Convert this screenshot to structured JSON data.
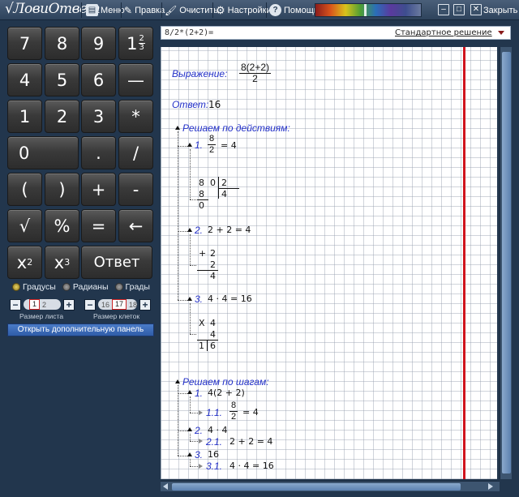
{
  "titlebar": {
    "app_title": "ЛовиОтвет",
    "menu_label": "Меню",
    "edit_label": "Правка",
    "clear_label": "Очистить",
    "settings_label": "Настройки",
    "help_label": "Помощь",
    "help_icon": "?",
    "close_label": "Закрыть"
  },
  "keypad": {
    "keys": [
      {
        "id": "key-7",
        "label": "7"
      },
      {
        "id": "key-8",
        "label": "8"
      },
      {
        "id": "key-9",
        "label": "9"
      },
      {
        "id": "key-4",
        "label": "4"
      },
      {
        "id": "key-5",
        "label": "5"
      },
      {
        "id": "key-6",
        "label": "6"
      },
      {
        "id": "key-fraction-bar",
        "label": "—"
      },
      {
        "id": "key-1",
        "label": "1"
      },
      {
        "id": "key-2",
        "label": "2"
      },
      {
        "id": "key-3",
        "label": "3"
      },
      {
        "id": "key-multiply",
        "label": "*"
      },
      {
        "id": "key-0",
        "label": "0"
      },
      {
        "id": "key-dot",
        "label": "."
      },
      {
        "id": "key-divide",
        "label": "/"
      },
      {
        "id": "key-open-paren",
        "label": "("
      },
      {
        "id": "key-close-paren",
        "label": ")"
      },
      {
        "id": "key-plus",
        "label": "+"
      },
      {
        "id": "key-minus",
        "label": "-"
      },
      {
        "id": "key-sqrt",
        "label": "√"
      },
      {
        "id": "key-percent",
        "label": "%"
      },
      {
        "id": "key-equals",
        "label": "="
      },
      {
        "id": "key-backspace",
        "label": "←"
      }
    ],
    "mixed_whole": "1",
    "mixed_num": "2",
    "mixed_den": "3",
    "x": "x",
    "sq_exp": "2",
    "cube_exp": "3",
    "answer_label": "Ответ",
    "angle_modes": [
      "Градусы",
      "Радианы",
      "Грады"
    ],
    "sheet_size": {
      "prev": "",
      "current": "1",
      "next": "2",
      "label": "Размер листа"
    },
    "cell_size": {
      "prev": "16",
      "current": "17",
      "next": "18",
      "label": "Размер клеток"
    },
    "extra_panel_label": "Открыть дополнительную панель"
  },
  "expression_bar": {
    "expression": "8/2*(2+2)=",
    "mode": "Стандартное решение"
  },
  "solution": {
    "expr_label": "Выражение:",
    "expr_num": "8(2+2)",
    "expr_den": "2",
    "answer_label": "Ответ:",
    "answer_value": "16",
    "by_actions_label": "Решаем по действиям:",
    "a1": {
      "num_label": "1.",
      "num": "8",
      "den": "2",
      "eq": "= 4",
      "div_dividend": "8",
      "div_zero": "0",
      "div_divisor": "2",
      "div_quot": "4",
      "div_sub": "8",
      "div_rem": "0"
    },
    "a2": {
      "num_label": "2.",
      "expr": "2 + 2 = 4",
      "add_plus": "+",
      "add_a": "2",
      "add_b": "2",
      "add_sum": "4"
    },
    "a3": {
      "num_label": "3.",
      "expr": "4 · 4 = 16",
      "mul_x": "X",
      "mul_a": "4",
      "mul_b": "4",
      "mul_r1": "1",
      "mul_r2": "6"
    },
    "by_steps_label": "Решаем по шагам:",
    "s1": {
      "num_label": "1.",
      "expr": "4(2 + 2)"
    },
    "s11": {
      "num_label": "1.1.",
      "num": "8",
      "den": "2",
      "eq": "= 4"
    },
    "s2": {
      "num_label": "2.",
      "expr": "4 · 4"
    },
    "s21": {
      "num_label": "2.1.",
      "expr": "2 + 2 = 4"
    },
    "s3": {
      "num_label": "3.",
      "expr": "16"
    },
    "s31": {
      "num_label": "3.1.",
      "expr": "4 · 4 = 16"
    }
  },
  "colors": {
    "margin_line": "#d0141e",
    "step_label": "#2330c8",
    "app_bg": "#22364d"
  }
}
